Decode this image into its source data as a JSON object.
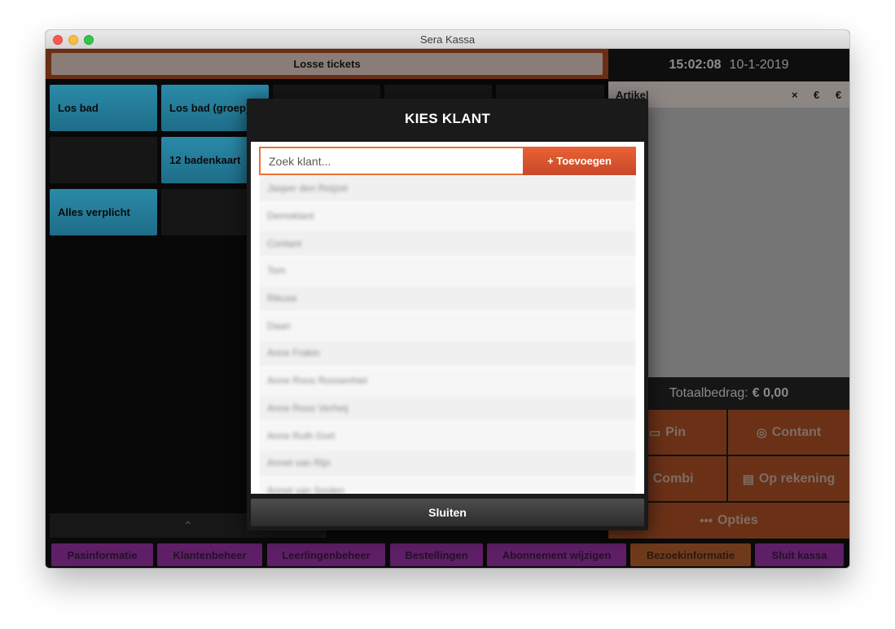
{
  "window": {
    "title": "Sera Kassa"
  },
  "left": {
    "tab_label": "Losse tickets",
    "tiles": [
      "Los bad",
      "Los bad (groep)",
      "12 badenkaart",
      "Alles verplicht"
    ],
    "scroll_up_icon": "chevron-up-icon"
  },
  "right": {
    "time": "15:02:08",
    "date": "10-1-2019",
    "order_headers": {
      "article": "Artikel",
      "remove": "×",
      "price": "€",
      "total": "€"
    },
    "total_label": "Totaalbedrag:",
    "total_value": "€ 0,00",
    "pay_buttons": [
      {
        "label": "Pin",
        "icon": "card-icon"
      },
      {
        "label": "Contant",
        "icon": "coins-icon"
      },
      {
        "label": "Combi",
        "icon": "combi-icon"
      },
      {
        "label": "Op rekening",
        "icon": "receipt-icon"
      },
      {
        "label": "Opties",
        "icon": "dots-icon"
      }
    ]
  },
  "modal": {
    "title": "KIES KLANT",
    "search_placeholder": "Zoek klant...",
    "add_label": "+ Toevoegen",
    "customers": [
      "Jasper den Reijzel",
      "Demoklant",
      "Contant",
      "Tom",
      "Rikuse",
      "Daan",
      "Anne Frakin",
      "Anne Roos Roosenhiel",
      "Anne Roos Verheij",
      "Anne Ruth Gort",
      "Annet van Rijn",
      "Annet van Soolen"
    ],
    "close_label": "Sluiten"
  },
  "bottom": {
    "buttons": [
      "Pasinformatie",
      "Klantenbeheer",
      "Leerlingenbeheer",
      "Bestellingen",
      "Abonnement wijzigen",
      "Bezoekinformatie",
      "Sluit kassa"
    ]
  },
  "colors": {
    "accent": "#e8612f",
    "tile_blue": "#2583a2",
    "purple": "#5e1f66"
  }
}
